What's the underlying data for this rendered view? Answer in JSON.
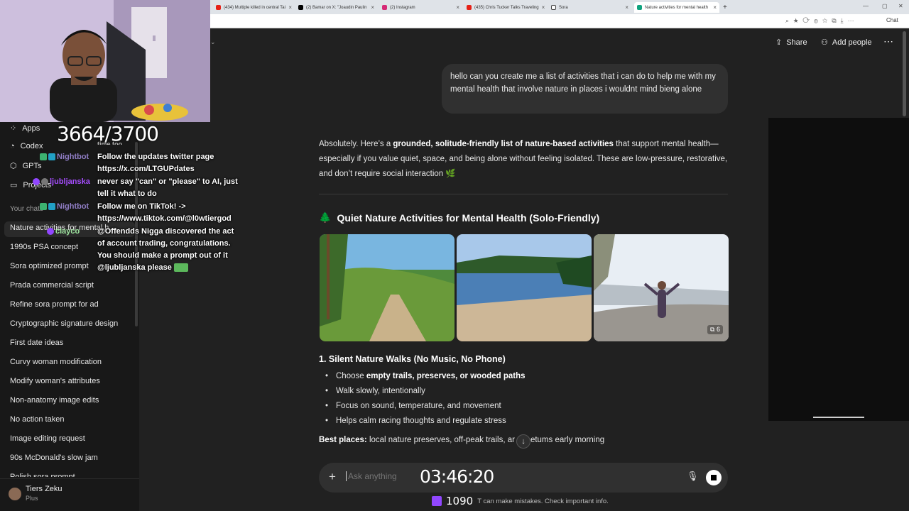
{
  "browser": {
    "tabs": [
      {
        "title": "(434) Multiple killed in central Tai",
        "icon_color": "#e62117"
      },
      {
        "title": "(2) Bamar on X: \"Joaudin Paulin",
        "icon_color": "#000000"
      },
      {
        "title": "(2) Instagram",
        "icon_color": "#d62976"
      },
      {
        "title": "(435) Chris Tucker Talks Traveling",
        "icon_color": "#e62117"
      },
      {
        "title": "Sora",
        "icon_color": "#444444"
      },
      {
        "title": "Nature activities for mental health",
        "icon_color": "#10a37f",
        "active": true
      }
    ],
    "chat_label": "Chat"
  },
  "sidebar": {
    "nav": [
      {
        "label": "Apps",
        "icon": "apps-icon"
      },
      {
        "label": "Codex",
        "icon": "codex-icon"
      },
      {
        "label": "GPTs",
        "icon": "gpts-icon"
      },
      {
        "label": "Projects",
        "icon": "folder-icon"
      }
    ],
    "section_label": "Your chats",
    "chats": [
      "Nature activities for mental h",
      "1990s PSA concept",
      "Sora optimized prompt",
      "Prada commercial script",
      "Refine sora prompt for ad",
      "Cryptographic signature design",
      "First date ideas",
      "Curvy woman modification",
      "Modify woman's attributes",
      "Non-anatomy image edits",
      "No action taken",
      "Image editing request",
      "90s McDonald's slow jam",
      "Polish sora prompt"
    ],
    "user": {
      "name": "Tiers Zeku",
      "plan": "Plus"
    }
  },
  "overlay": {
    "counter": "3664/3700",
    "chat": [
      {
        "user": "Nightbot",
        "user_color": "#8e7cc3",
        "lines": [
          "Follow the updates twitter page",
          "https://x.com/LTGUPdates"
        ]
      },
      {
        "user": "ljubljanska",
        "user_color": "#a64dff",
        "lines": [
          "never say \"can\" or \"please\" to AI, just",
          "tell it what to do"
        ]
      },
      {
        "user": "Nightbot",
        "user_color": "#8e7cc3",
        "lines": [
          "Follow me on TikTok! ->",
          "https://www.tiktok.com/@l0wtiergod"
        ]
      },
      {
        "user": "clayco",
        "user_color": "#9fe6a0",
        "lines": [
          "@Offendds Nigga discovered the act",
          "of account trading, congratulations.",
          "You should make a prompt out of it",
          "@ljubljanska please"
        ]
      }
    ],
    "chat_partial_top": "time too",
    "timer": "03:46:20",
    "viewers": "1090"
  },
  "header": {
    "share_label": "Share",
    "add_people_label": "Add people"
  },
  "conversation": {
    "user_message": "hello can you create me a list of activities that i can do to help me with my mental health that involve nature in places i wouldnt mind bieng alone",
    "intro_1": "Absolutely. Here’s a ",
    "intro_bold": "grounded, solitude-friendly list of nature-based activities",
    "intro_2": " that support mental health—especially if you value quiet, space, and being alone without feeling isolated. These are low-pressure, restorative, and don’t require social interaction 🌿",
    "section_emoji": "🌲",
    "section_title": "Quiet Nature Activities for Mental Health (Solo-Friendly)",
    "image_count": "6",
    "walk_heading": "1. Silent Nature Walks (No Music, No Phone)",
    "bullets": [
      {
        "pre": "Choose ",
        "bold": "empty trails, preserves, or wooded paths",
        "post": ""
      },
      {
        "pre": "Walk slowly, intentionally",
        "bold": "",
        "post": ""
      },
      {
        "pre": "Focus on sound, temperature, and movement",
        "bold": "",
        "post": ""
      },
      {
        "pre": "Helps calm racing thoughts and regulate stress",
        "bold": "",
        "post": ""
      }
    ],
    "best_label": "Best places:",
    "best_text": " local nature preserves, off-peak trails, ar",
    "best_text_2": "etums early morning"
  },
  "composer": {
    "placeholder": "Ask anything",
    "disclaimer": "T can make mistakes. Check important info."
  }
}
